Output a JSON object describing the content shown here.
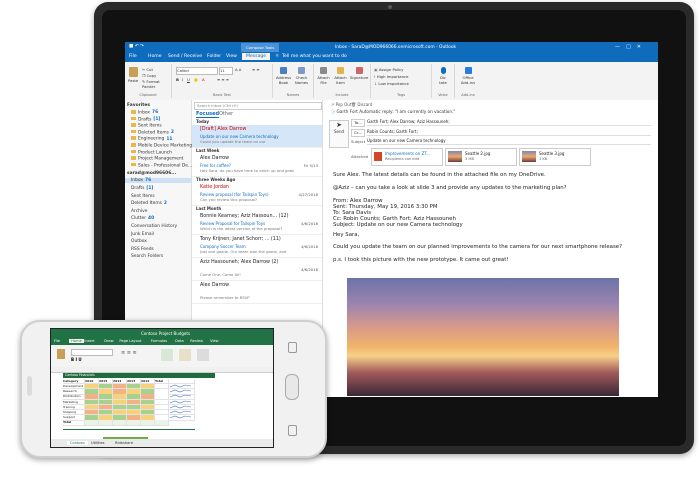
{
  "outlook": {
    "title": "Inbox - SaraD@MOD966066.onmicrosoft.com - Outlook",
    "compose_tools": "Compose Tools",
    "tabs": [
      "File",
      "Home",
      "Send / Receive",
      "Folder",
      "View",
      "Message"
    ],
    "tell_me": "Tell me what you want to do",
    "ribbon_groups": [
      "Clipboard",
      "Basic Text",
      "Names",
      "Include",
      "Tags",
      "Voice",
      "Add-ins"
    ],
    "ribbon": {
      "paste": "Paste",
      "cut": "Cut",
      "copy": "Copy",
      "format_painter": "Format Painter",
      "font": "Calibri",
      "size": "11",
      "address_book": "Address Book",
      "check_names": "Check Names",
      "attach_file": "Attach File",
      "attach_item": "Attach Item",
      "signature": "Signature",
      "assign_policy": "Assign Policy",
      "high_importance": "High Importance",
      "low_importance": "Low Importance",
      "dictate": "Dic tate",
      "office_addins": "Office Add-ins"
    },
    "folders": {
      "favorites": "Favorites",
      "fav_items": [
        {
          "name": "Inbox",
          "count": "76"
        },
        {
          "name": "Drafts",
          "count": "[1]"
        },
        {
          "name": "Sent Items",
          "count": ""
        },
        {
          "name": "Deleted Items",
          "count": "2"
        },
        {
          "name": "Engineering",
          "count": "11"
        },
        {
          "name": "Mobile Device Marketing",
          "count": ""
        },
        {
          "name": "Product Launch",
          "count": ""
        },
        {
          "name": "Project Management",
          "count": ""
        },
        {
          "name": "Sales - Professional De...",
          "count": ""
        }
      ],
      "account": "sarad@mod96606...",
      "acct_items": [
        {
          "name": "Inbox",
          "count": "76"
        },
        {
          "name": "Drafts",
          "count": "[1]"
        },
        {
          "name": "Sent Items",
          "count": ""
        },
        {
          "name": "Deleted Items",
          "count": "2"
        },
        {
          "name": "Archive",
          "count": ""
        },
        {
          "name": "Clutter",
          "count": "40"
        },
        {
          "name": "Conversation History",
          "count": ""
        },
        {
          "name": "Junk Email",
          "count": ""
        },
        {
          "name": "Outbox",
          "count": ""
        },
        {
          "name": "RSS Feeds",
          "count": ""
        },
        {
          "name": "Search Folders",
          "count": ""
        }
      ]
    },
    "list": {
      "search": "Search Inbox (Ctrl+E)",
      "focused": "Focused",
      "other": "Other",
      "groups": [
        "Today",
        "Last Week",
        "Three Weeks Ago",
        "Last Month"
      ],
      "messages": [
        {
          "from": "[Draft] Alex Darrow",
          "subject": "Update on our new Camera technology",
          "preview": "Could you update the team on our",
          "date": ""
        },
        {
          "from": "Alex Darrow",
          "subject": "Free for coffee?",
          "preview": "Hey Sara, do you have time to catch up and grab",
          "date": "Fri 5/13"
        },
        {
          "from": "Katie Jordan",
          "subject": "Review proposal (for Tailspin Toys)",
          "preview": "Can you review this proposal?",
          "date": "4/27/2016"
        },
        {
          "from": "Bonnie Kearney; Aziz Hassoun... (12)",
          "subject": "Review Proposal for Tailspin Toys",
          "preview": "Which is the latest version of the proposal?",
          "date": "4/6/2016"
        },
        {
          "from": "Tony Krijnen; Janet Schorr; ... (11)",
          "subject": "Company Soccer Team",
          "preview": "Just one goalie. Our team won the game, and",
          "date": "4/6/2016"
        },
        {
          "from": "Aziz Hassouneh; Alex Darrow (2)",
          "subject": "",
          "preview": "Come One, Come All!",
          "date": "4/6/2016"
        },
        {
          "from": "Alex Darrow",
          "subject": "",
          "preview": "Please remember to RSVP",
          "date": ""
        }
      ]
    },
    "reading": {
      "popout": "Pop Out",
      "discard": "Discard",
      "auto_reply": "Garth Fort  Automatic reply: \"I am currently on vacation.\"",
      "send": "Send",
      "to_label": "To...",
      "cc_label": "Cc...",
      "subject_label": "Subject",
      "attached_label": "Attached",
      "to": "Garth Fort;  Alex Darrow;  Aziz Hassouneh;",
      "cc": "Robin Counts;  Garth Fort;",
      "subject": "Update on our new Camera technology",
      "attachments": [
        {
          "name": "Improvements on ZT...",
          "info": "Recipients can edit"
        },
        {
          "name": "Seattle 2.jpg",
          "info": "3 MB"
        },
        {
          "name": "Seattle 3.jpg",
          "info": "1 KB"
        }
      ],
      "body": [
        "Sure Alex. The latest details can be found in the attached file on my OneDrive.",
        "@Aziz – can you take a look at slide 3 and provide any updates to the marketing plan?",
        "From: Alex Darrow",
        "Sent: Thursday, May 19, 2016 3:30 PM",
        "To: Sara Davis",
        "Cc: Robin Counts; Garth Fort; Aziz Hassouneh",
        "Subject: Update on our new Camera technology",
        "Hey Sara,",
        "Could you update the team on our planned improvements to the camera for our next smartphone release?",
        "p.s. I took this picture with the new prototype. It came out great!"
      ]
    }
  },
  "excel": {
    "title": "Contoso Project Budgets",
    "tabs": [
      "File",
      "Home",
      "Insert",
      "Draw",
      "Page Layout",
      "Formulas",
      "Data",
      "Review",
      "View"
    ],
    "sheet_title": "Contoso Financials",
    "columns": [
      "Category",
      "2016",
      "2015",
      "2014",
      "2013",
      "2012",
      "Total",
      ""
    ],
    "rows": [
      "Development",
      "Research",
      "Distribution",
      "Marketing",
      "Training",
      "Shipping",
      "Support",
      "Total"
    ],
    "sheets": [
      "Contoso",
      "Utilities",
      "Rideshare"
    ]
  },
  "colors": {
    "outlook_blue": "#0f6cbd",
    "excel_green": "#217346"
  }
}
